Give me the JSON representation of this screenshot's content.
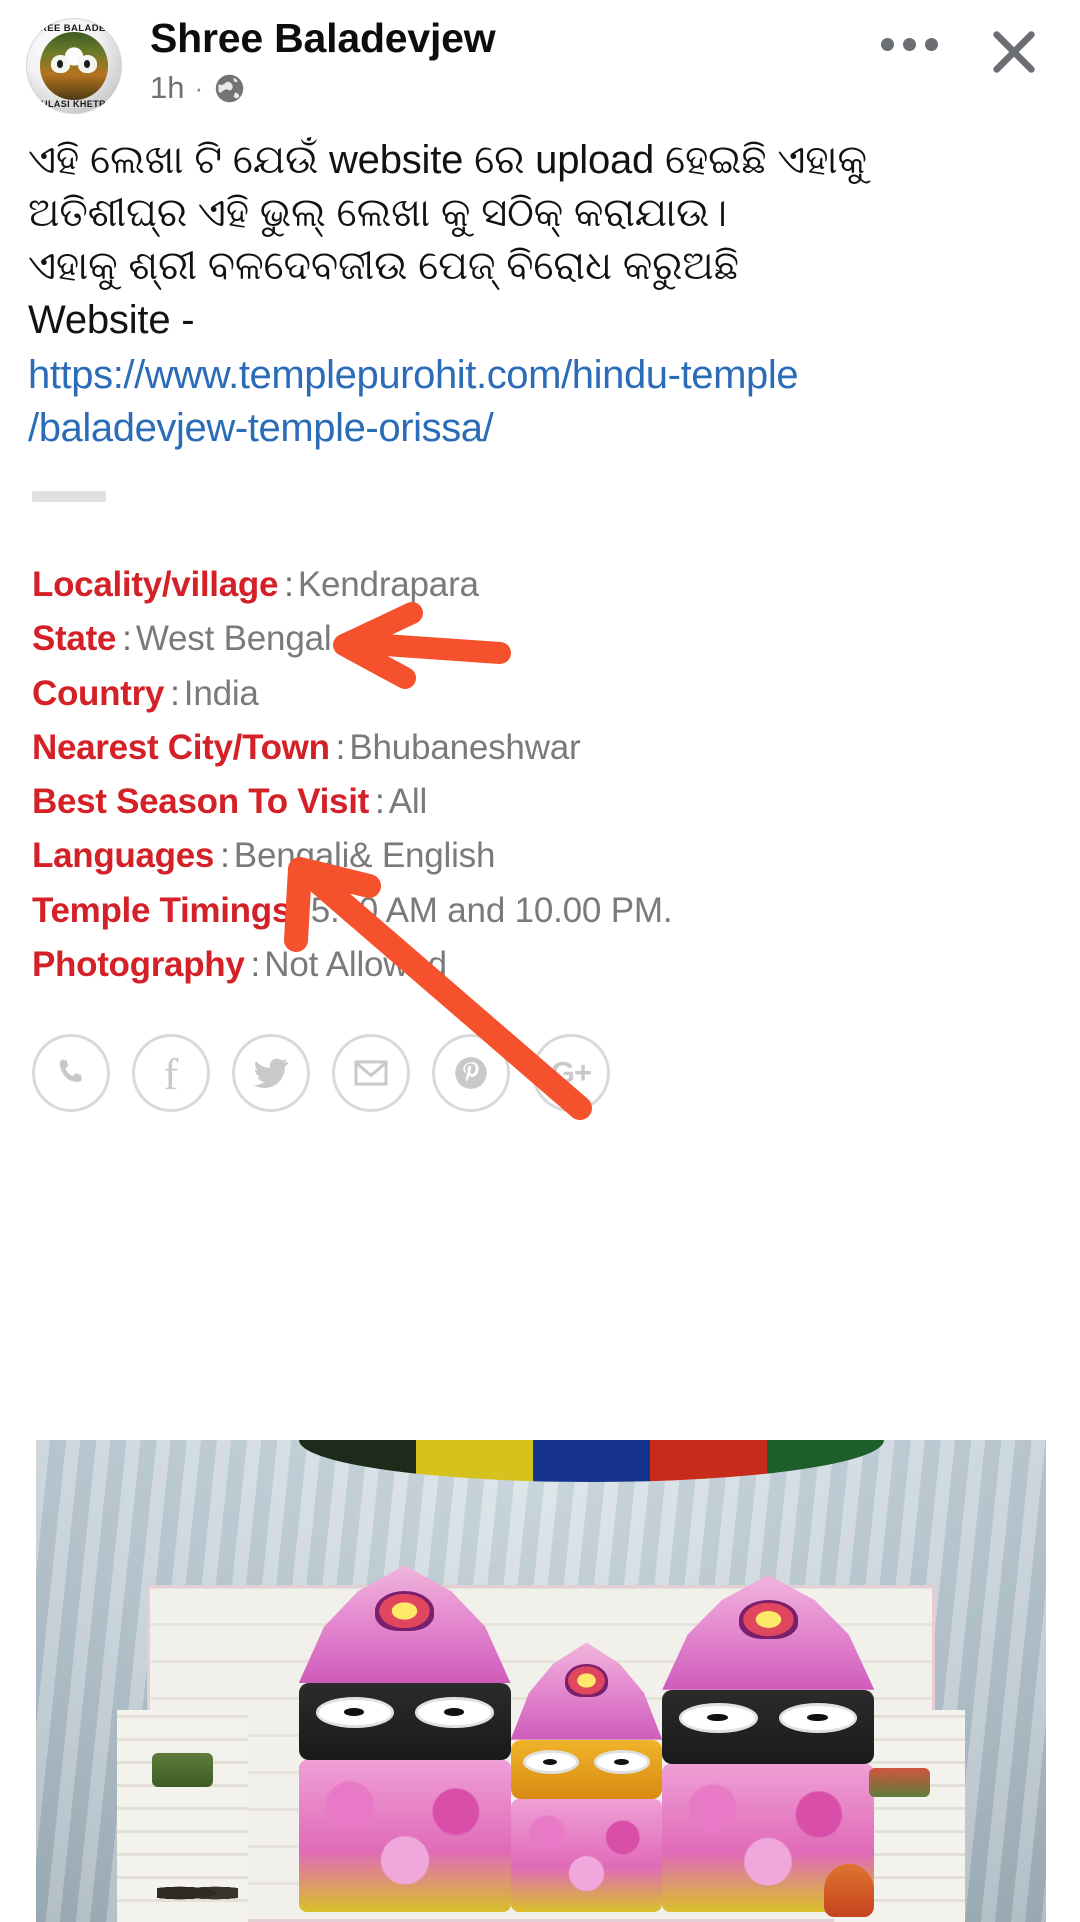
{
  "header": {
    "page_name": "Shree Baladevjew",
    "timestamp": "1h",
    "separator": "·",
    "privacy_icon": "globe-icon",
    "more_icon": "ellipsis-icon",
    "close_icon": "close-icon",
    "avatar": {
      "ring_top_text": "SHREE BALADEVJEW",
      "ring_bottom_text": "TULASI KHETRA"
    }
  },
  "post": {
    "lines": [
      "ଏହି ଲେଖା ଟି ଯେଉଁ website ରେ upload ହେଇଛି ଏହାକୁ",
      "ଅତିଶୀଘ୍ର ଏହି ଭୁଲ୍ ଲେଖା କୁ ସଠିକ୍ କରାଯାଉ।",
      "ଏହାକୁ ଶ୍ରୀ ବଳଦେବଜୀଉ ପେଜ୍ ବିରୋଧ କରୁଅଛି",
      "Website -"
    ],
    "link_lines": [
      "https://www.templepurohit.com/hindu-temple",
      "/baladevjew-temple-orissa/"
    ]
  },
  "details": {
    "separator": ":",
    "rows": [
      {
        "label": "Locality/village",
        "value": "Kendrapara"
      },
      {
        "label": "State",
        "value": "West Bengal"
      },
      {
        "label": "Country",
        "value": "India"
      },
      {
        "label": "Nearest City/Town",
        "value": "Bhubaneshwar"
      },
      {
        "label": "Best Season To Visit",
        "value": "All"
      },
      {
        "label": "Languages",
        "value": "Bengali& English"
      },
      {
        "label": "Temple Timings",
        "value": "5.00 AM and 10.00 PM."
      },
      {
        "label": "Photography",
        "value": "Not Allowed"
      }
    ]
  },
  "social": {
    "icons": [
      {
        "name": "phone-icon",
        "label": "Phone"
      },
      {
        "name": "facebook-icon",
        "label": "f"
      },
      {
        "name": "twitter-icon",
        "label": "Twitter"
      },
      {
        "name": "email-icon",
        "label": "Email"
      },
      {
        "name": "pinterest-icon",
        "label": "Pinterest"
      },
      {
        "name": "google-plus-icon",
        "label": "G+"
      }
    ]
  },
  "photo": {
    "alt": "Jagannath, Balabhadra and Subhadra deities on temple altar"
  },
  "colors": {
    "label_red": "#d42027",
    "value_gray": "#7a7a7a",
    "link_blue": "#2b6cb8",
    "annotation_orange": "#f4512c",
    "text_black": "#121212",
    "meta_gray": "#707070",
    "icon_gray": "#c9c9c9"
  }
}
